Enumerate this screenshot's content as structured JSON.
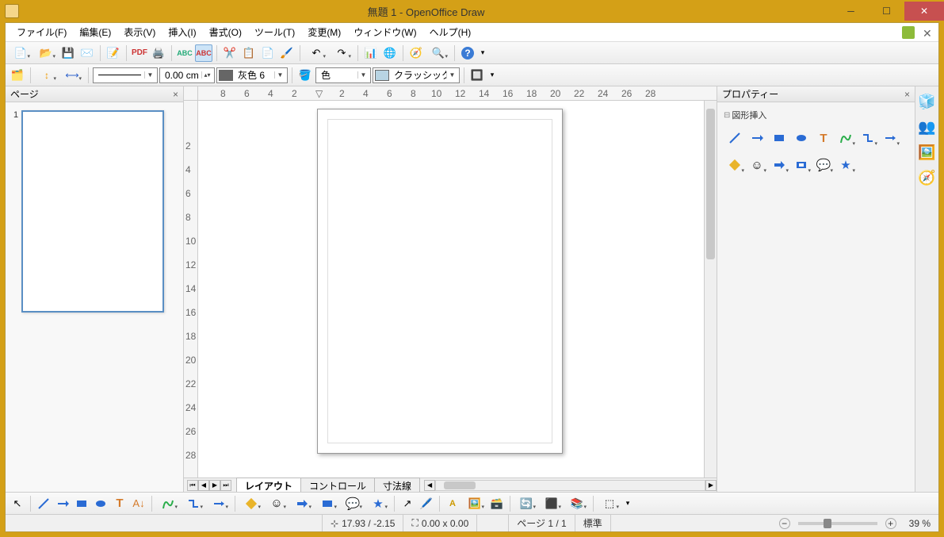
{
  "window": {
    "title": "無題 1 - OpenOffice Draw"
  },
  "menu": {
    "file": "ファイル(F)",
    "edit": "編集(E)",
    "view": "表示(V)",
    "insert": "挿入(I)",
    "format": "書式(O)",
    "tools": "ツール(T)",
    "modify": "変更(M)",
    "window": "ウィンドウ(W)",
    "help": "ヘルプ(H)"
  },
  "toolbar2": {
    "line_width": "0.00 cm",
    "line_color_name": "灰色 6",
    "line_color": "#666666",
    "fill_label": "色",
    "fill_style": "クラッシックな",
    "fill_swatch": "#b8d4e3"
  },
  "pages_panel": {
    "title": "ページ",
    "pages": [
      "1"
    ]
  },
  "ruler": {
    "h": [
      "8",
      "6",
      "4",
      "2",
      "",
      "2",
      "4",
      "6",
      "8",
      "10",
      "12",
      "14",
      "16",
      "18",
      "20",
      "22",
      "24",
      "26",
      "28"
    ],
    "v": [
      "2",
      "4",
      "6",
      "8",
      "10",
      "12",
      "14",
      "16",
      "18",
      "20",
      "22",
      "24",
      "26",
      "28"
    ]
  },
  "tabs": {
    "layout": "レイアウト",
    "control": "コントロール",
    "dim": "寸法線"
  },
  "props": {
    "title": "プロパティー",
    "insert_shapes": "図形挿入"
  },
  "status": {
    "coords": "17.93 / -2.15",
    "size": "0.00 x 0.00",
    "page": "ページ 1 / 1",
    "mode": "標準",
    "zoom": "39 %"
  },
  "chart_data": null
}
